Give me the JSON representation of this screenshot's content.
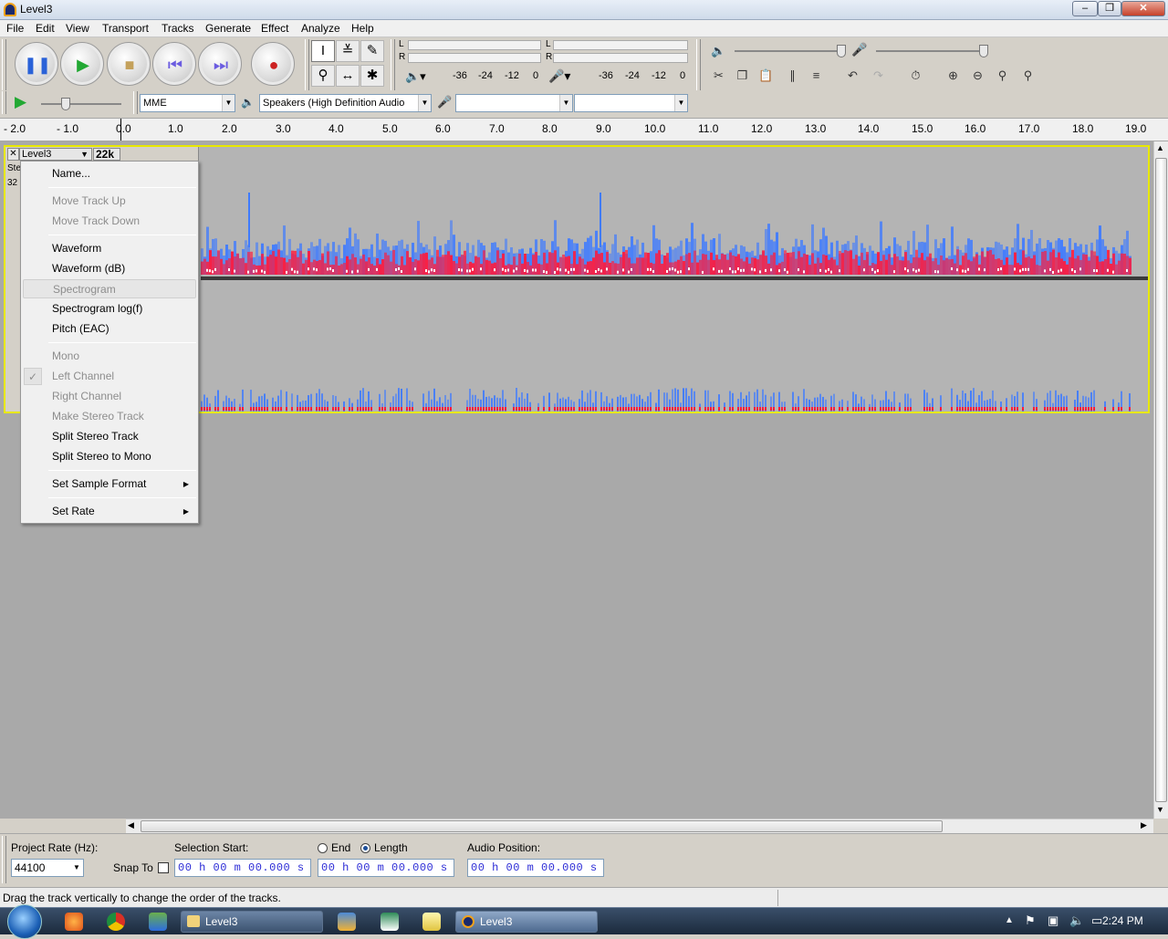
{
  "window": {
    "title": "Level3"
  },
  "menubar": [
    "File",
    "Edit",
    "View",
    "Transport",
    "Tracks",
    "Generate",
    "Effect",
    "Analyze",
    "Help"
  ],
  "meters": {
    "play_scale": [
      "-36",
      "-24",
      "-12",
      "0"
    ],
    "rec_scale": [
      "-36",
      "-24",
      "-12",
      "0"
    ],
    "channel_l": "L",
    "channel_r": "R"
  },
  "device": {
    "host": "MME",
    "output": "Speakers (High Definition Audio",
    "input": "",
    "channels": ""
  },
  "ruler": {
    "ticks": [
      "- 2.0",
      "- 1.0",
      "0.0",
      "1.0",
      "2.0",
      "3.0",
      "4.0",
      "5.0",
      "6.0",
      "7.0",
      "8.0",
      "9.0",
      "10.0",
      "11.0",
      "12.0",
      "13.0",
      "14.0",
      "15.0",
      "16.0",
      "17.0",
      "18.0",
      "19.0"
    ]
  },
  "track": {
    "name": "Level3",
    "rate_partial": "22k",
    "info_line1": "Ste",
    "info_line2": "32"
  },
  "context_menu": {
    "items": [
      {
        "label": "Name...",
        "enabled": true
      },
      {
        "label": "Move Track Up",
        "enabled": false
      },
      {
        "label": "Move Track Down",
        "enabled": false
      },
      {
        "label": "Waveform",
        "enabled": true
      },
      {
        "label": "Waveform (dB)",
        "enabled": true
      },
      {
        "label": "Spectrogram",
        "enabled": false,
        "highlighted": true
      },
      {
        "label": "Spectrogram log(f)",
        "enabled": true
      },
      {
        "label": "Pitch (EAC)",
        "enabled": true
      },
      {
        "label": "Mono",
        "enabled": false
      },
      {
        "label": "Left Channel",
        "enabled": false,
        "checked": true
      },
      {
        "label": "Right Channel",
        "enabled": false
      },
      {
        "label": "Make Stereo Track",
        "enabled": false
      },
      {
        "label": "Split Stereo Track",
        "enabled": true
      },
      {
        "label": "Split Stereo to Mono",
        "enabled": true
      },
      {
        "label": "Set Sample Format",
        "enabled": true,
        "submenu": true
      },
      {
        "label": "Set Rate",
        "enabled": true,
        "submenu": true
      }
    ]
  },
  "selection_bar": {
    "project_rate_label": "Project Rate (Hz):",
    "project_rate": "44100",
    "snap_to_label": "Snap To",
    "selection_start_label": "Selection Start:",
    "end_label": "End",
    "length_label": "Length",
    "audio_position_label": "Audio Position:",
    "selection_start": "00 h 00 m 00.000 s",
    "selection_length": "00 h 00 m 00.000 s",
    "audio_position": "00 h 00 m 00.000 s"
  },
  "status": {
    "text": "Drag the track vertically to change the order of the tracks."
  },
  "taskbar": {
    "buttons": [
      "Level3",
      "Level3"
    ],
    "clock": "2:24 PM"
  },
  "colors": {
    "track_border": "#e8e800",
    "spectro_blue": "#3f7bff",
    "spectro_red": "#ff1a3c"
  }
}
